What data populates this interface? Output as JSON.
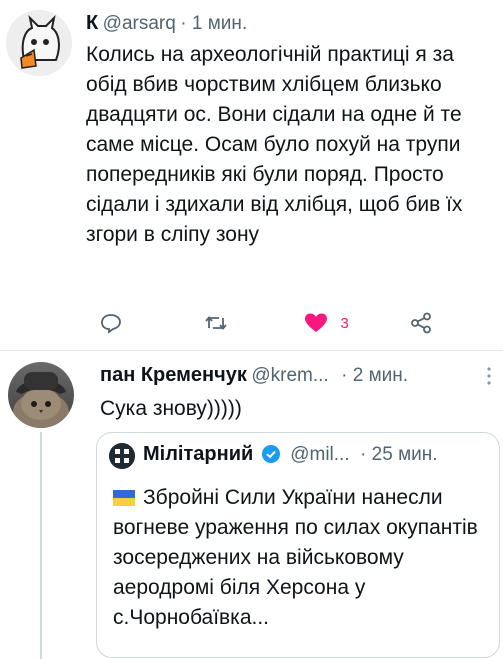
{
  "tweet1": {
    "name": "К",
    "handle": "@arsarq",
    "time": "· 1 мин.",
    "text": "Колись на археологічній практиці я за обід вбив чорствим хлібцем близько двадцяти ос. Вони сідали на одне й те саме місце. Осам було похуй на трупи попередників які були поряд. Просто сідали і здихали від хлібця, щоб бив їх згори в сліпу зону",
    "likes": "3"
  },
  "tweet2": {
    "name": "пан Кременчук",
    "handle": "@krem...",
    "time": "· 2 мин.",
    "text": "Сука знову)))))"
  },
  "quote": {
    "name": "Мілітарний",
    "handle": "@mil...",
    "time": "· 25 мин.",
    "text": "Збройні Сили України нанесли вогневе ураження по силах окупантів зосереджених на військовому аеродромі біля Херсона у с.Чорнобаївка..."
  },
  "colors": {
    "like_pink": "#f91880",
    "verified_blue": "#1d9bf0"
  }
}
